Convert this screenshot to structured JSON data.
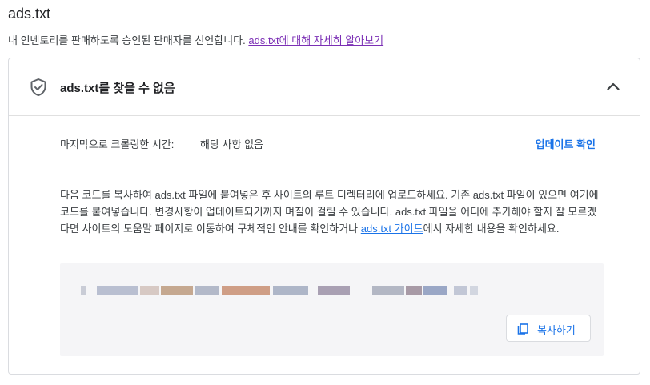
{
  "page": {
    "title": "ads.txt",
    "subtitle": "내 인벤토리를 판매하도록 승인된 판매자를 선언합니다. ",
    "learn_more_link": "ads.txt에 대해 자세히 알아보기"
  },
  "card": {
    "header_title": "ads.txt를 찾을 수 없음",
    "last_crawl_label": "마지막으로 크롤링한 시간:",
    "last_crawl_value": "해당 사항 없음",
    "check_update": "업데이트 확인",
    "description_before_link": "다음 코드를 복사하여 ads.txt 파일에 붙여넣은 후 사이트의 루트 디렉터리에 업로드하세요. 기존 ads.txt 파일이 있으면 여기에 코드를 붙여넣습니다. 변경사항이 업데이트되기까지 며칠이 걸릴 수 있습니다. ads.txt 파일을 어디에 추가해야 할지 잘 모르겠다면 사이트의 도움말 페이지로 이동하여 구체적인 안내를 확인하거나 ",
    "guide_link": "ads.txt 가이드",
    "description_after_link": "에서 자세한 내용을 확인하세요.",
    "copy_button": "복사하기"
  },
  "colors": {
    "link_visited": "#7b2fb5",
    "link": "#1a73e8",
    "code_bg": "#f5f5f7"
  },
  "icons": {
    "header": "shield-icon",
    "collapse": "chevron-up-icon",
    "copy": "copy-icon"
  }
}
